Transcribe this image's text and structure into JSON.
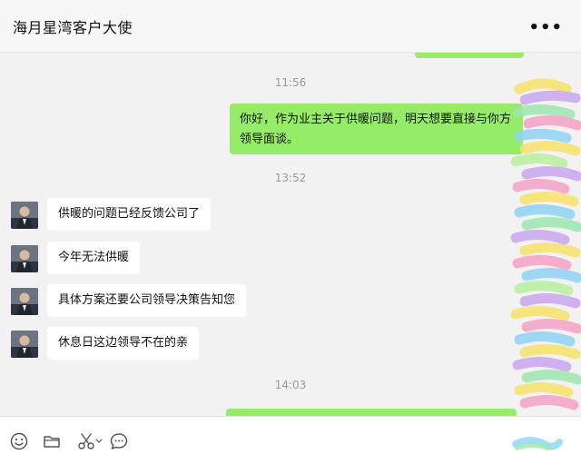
{
  "header": {
    "title": "海月星湾客户大使",
    "more_label": "•••"
  },
  "chat": {
    "messages": [
      {
        "type": "time",
        "text": "11:56"
      },
      {
        "type": "outgoing",
        "text": "你好，作为业主关于供暖问题，明天想要直接与你方领导面谈。"
      },
      {
        "type": "time",
        "text": "13:52"
      },
      {
        "type": "incoming",
        "text": "供暖的问题已经反馈公司了"
      },
      {
        "type": "incoming",
        "text": "今年无法供暖"
      },
      {
        "type": "incoming",
        "text": "具体方案还要公司领导决策告知您"
      },
      {
        "type": "incoming",
        "text": "休息日这边领导不在的亲"
      },
      {
        "type": "time",
        "text": "14:03"
      }
    ]
  },
  "toolbar": {
    "icons": [
      "emoji-icon",
      "folder-icon",
      "scissors-icon",
      "chat-history-icon"
    ]
  },
  "colors": {
    "outgoing_bubble": "#95ec69",
    "incoming_bubble": "#ffffff",
    "chat_background": "#f2f2f2",
    "header_background": "#f7f7f7"
  }
}
